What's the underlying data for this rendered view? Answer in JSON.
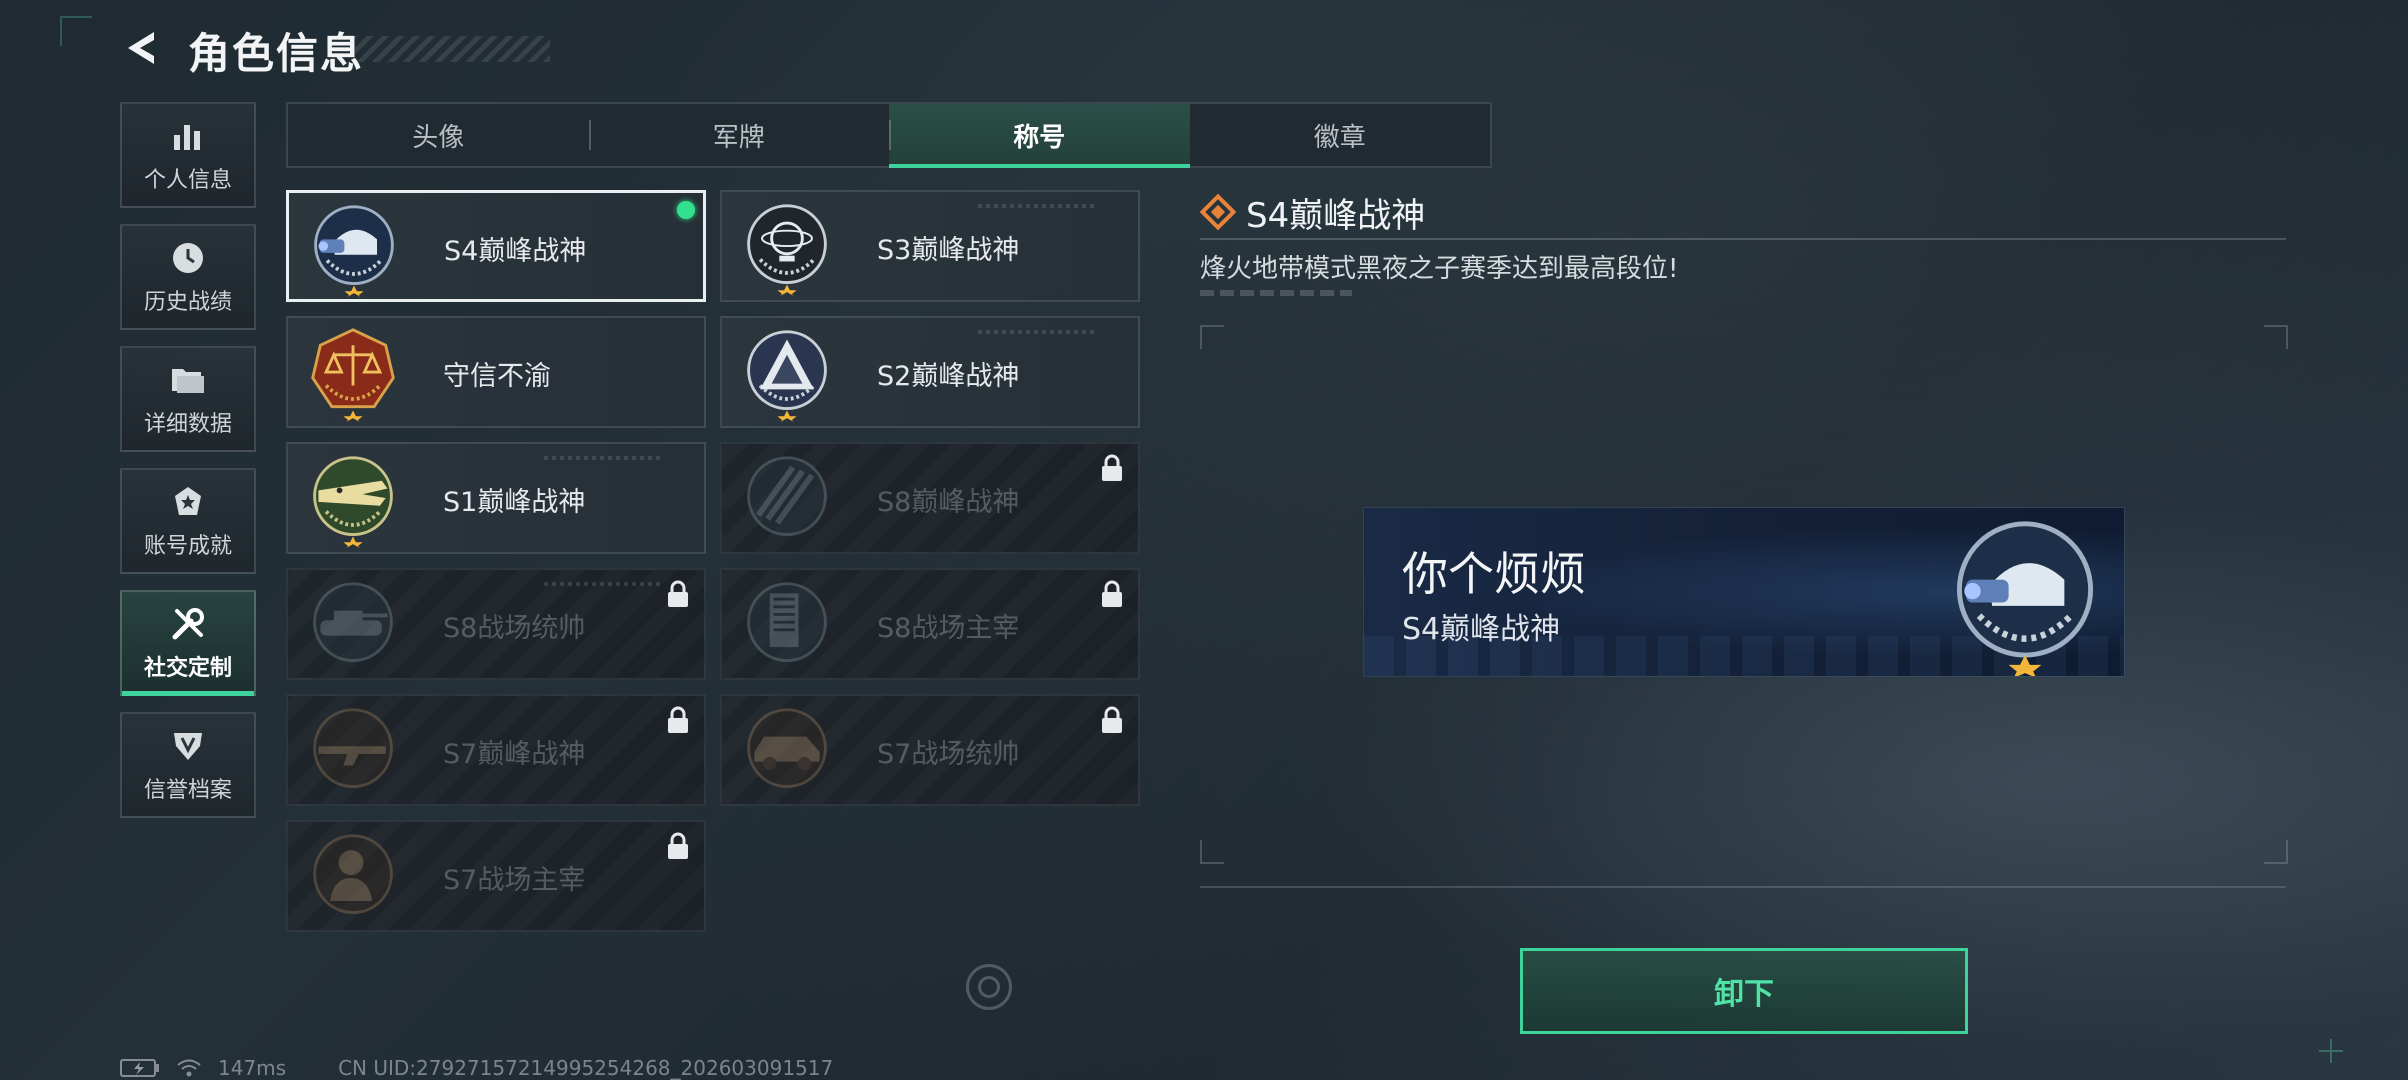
{
  "header": {
    "title": "角色信息"
  },
  "sidebar": {
    "items": [
      {
        "label": "个人信息",
        "icon": "bar-chart-icon",
        "active": false
      },
      {
        "label": "历史战绩",
        "icon": "clock-icon",
        "active": false
      },
      {
        "label": "详细数据",
        "icon": "folder-icon",
        "active": false
      },
      {
        "label": "账号成就",
        "icon": "achievement-icon",
        "active": false
      },
      {
        "label": "社交定制",
        "icon": "tools-icon",
        "active": true
      },
      {
        "label": "信誉档案",
        "icon": "credit-shield-icon",
        "active": false
      }
    ]
  },
  "tabs": [
    {
      "label": "头像",
      "active": false
    },
    {
      "label": "军牌",
      "active": false
    },
    {
      "label": "称号",
      "active": true
    },
    {
      "label": "徽章",
      "active": false
    }
  ],
  "titles": [
    {
      "name": "S4巅峰战神",
      "emblem": "helmet-emblem-icon",
      "locked": false,
      "selected": true,
      "equipped": true
    },
    {
      "name": "S3巅峰战神",
      "emblem": "globe-emblem-icon",
      "locked": false,
      "selected": false
    },
    {
      "name": "守信不渝",
      "emblem": "scales-emblem-icon",
      "locked": false,
      "selected": false
    },
    {
      "name": "S2巅峰战神",
      "emblem": "pyramid-emblem-icon",
      "locked": false,
      "selected": false
    },
    {
      "name": "S1巅峰战神",
      "emblem": "crocodile-emblem-icon",
      "locked": false,
      "selected": false
    },
    {
      "name": "S8巅峰战神",
      "emblem": "stripes-emblem-icon",
      "locked": true,
      "selected": false
    },
    {
      "name": "S8战场统帅",
      "emblem": "tank-emblem-icon",
      "locked": true,
      "selected": false
    },
    {
      "name": "S8战场主宰",
      "emblem": "building-emblem-icon",
      "locked": true,
      "selected": false
    },
    {
      "name": "S7巅峰战神",
      "emblem": "rifle-emblem-icon",
      "locked": true,
      "selected": false
    },
    {
      "name": "S7战场统帅",
      "emblem": "vehicle-emblem-icon",
      "locked": true,
      "selected": false
    },
    {
      "name": "S7战场主宰",
      "emblem": "soldier-emblem-icon",
      "locked": true,
      "selected": false
    }
  ],
  "detail": {
    "title": "S4巅峰战神",
    "description": "烽火地带模式黑夜之子赛季达到最高段位!",
    "preview_player_name": "你个烦烦",
    "preview_title": "S4巅峰战神",
    "action_label": "卸下"
  },
  "footer": {
    "ping": "147ms",
    "uid": "CN UID:279271572149952542​68_202603091517"
  },
  "colors": {
    "accent": "#3ed39b",
    "detail_icon": "#e8833a"
  }
}
